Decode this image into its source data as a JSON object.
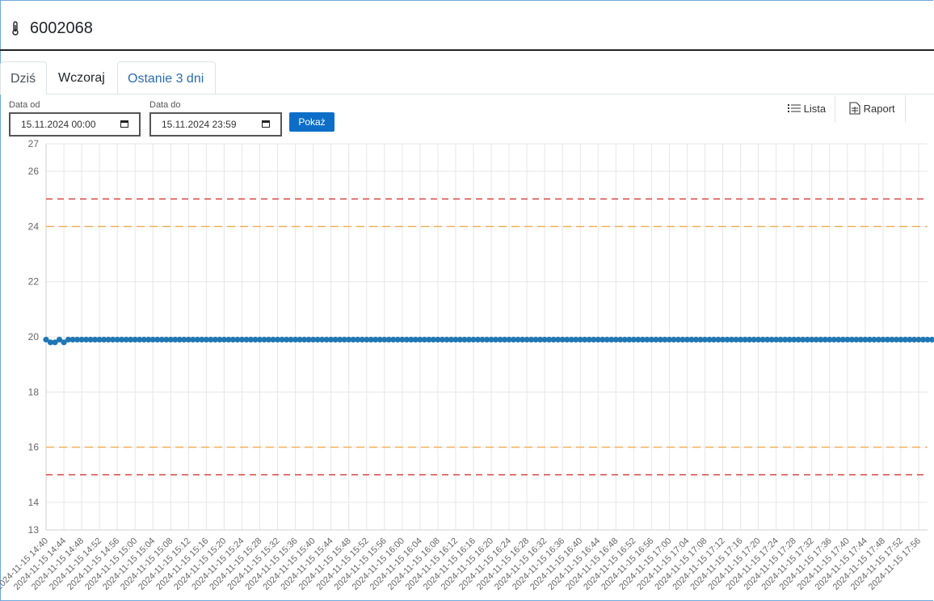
{
  "header": {
    "title": "6002068",
    "icon": "thermometer-icon"
  },
  "tabs": [
    {
      "label": "Dziś",
      "active": true
    },
    {
      "label": "Wczoraj",
      "active": false
    },
    {
      "label": "Ostanie 3 dni",
      "active": false
    }
  ],
  "filters": {
    "from_label": "Data od",
    "from_value": "15.11.2024 00:00",
    "to_label": "Data do",
    "to_value": "15.11.2024 23:59",
    "show_button": "Pokaż"
  },
  "toolbar": {
    "list_label": "Lista",
    "report_label": "Raport"
  },
  "colors": {
    "series": "#1f77b4",
    "alarm_line": "#d9534f",
    "warning_line": "#f0ad4e",
    "button": "#0d6ec8",
    "tab_link": "#2b6cb0"
  },
  "chart_data": {
    "type": "line",
    "ylim": [
      13,
      27
    ],
    "yticks": [
      "13",
      "14",
      "16",
      "18",
      "20",
      "22",
      "24",
      "26",
      "27"
    ],
    "grid": true,
    "x_labels": [
      "2024-11-15 14:40",
      "2024-11-15 14:44",
      "2024-11-15 14:48",
      "2024-11-15 14:52",
      "2024-11-15 14:56",
      "2024-11-15 15:00",
      "2024-11-15 15:04",
      "2024-11-15 15:08",
      "2024-11-15 15:12",
      "2024-11-15 15:16",
      "2024-11-15 15:20",
      "2024-11-15 15:24",
      "2024-11-15 15:28",
      "2024-11-15 15:32",
      "2024-11-15 15:36",
      "2024-11-15 15:40",
      "2024-11-15 15:44",
      "2024-11-15 15:48",
      "2024-11-15 15:52",
      "2024-11-15 15:56",
      "2024-11-15 16:00",
      "2024-11-15 16:04",
      "2024-11-15 16:08",
      "2024-11-15 16:12",
      "2024-11-15 16:16",
      "2024-11-15 16:20",
      "2024-11-15 16:24",
      "2024-11-15 16:28",
      "2024-11-15 16:32",
      "2024-11-15 16:36",
      "2024-11-15 16:40",
      "2024-11-15 16:44",
      "2024-11-15 16:48",
      "2024-11-15 16:52",
      "2024-11-15 16:56",
      "2024-11-15 17:00",
      "2024-11-15 17:04",
      "2024-11-15 17:08",
      "2024-11-15 17:12",
      "2024-11-15 17:16",
      "2024-11-15 17:20",
      "2024-11-15 17:24",
      "2024-11-15 17:28",
      "2024-11-15 17:32",
      "2024-11-15 17:36",
      "2024-11-15 17:40",
      "2024-11-15 17:44",
      "2024-11-15 17:48",
      "2024-11-15 17:52",
      "2024-11-15 17:56"
    ],
    "x_start": "2024-11-15 14:40",
    "x_end": "2024-11-15 17:58",
    "sample_interval_min": 1,
    "series": [
      {
        "values": [
          19.9,
          19.8,
          19.8,
          19.9,
          19.8,
          19.9,
          19.9,
          19.9,
          19.9,
          19.9,
          19.9,
          19.9,
          19.9,
          19.9,
          19.9,
          19.9,
          19.9,
          19.9,
          19.9,
          19.9,
          19.9,
          19.9,
          19.9,
          19.9,
          19.9,
          19.9,
          19.9,
          19.9,
          19.9,
          19.9,
          19.9,
          19.9,
          19.9,
          19.9,
          19.9,
          19.9,
          19.9,
          19.9,
          19.9,
          19.9,
          19.9,
          19.9,
          19.9,
          19.9,
          19.9,
          19.9,
          19.9,
          19.9,
          19.9,
          19.9,
          19.9,
          19.9,
          19.9,
          19.9,
          19.9,
          19.9,
          19.9,
          19.9,
          19.9,
          19.9,
          19.9,
          19.9,
          19.9,
          19.9,
          19.9,
          19.9,
          19.9,
          19.9,
          19.9,
          19.9,
          19.9,
          19.9,
          19.9,
          19.9,
          19.9,
          19.9,
          19.9,
          19.9,
          19.9,
          19.9,
          19.9,
          19.9,
          19.9,
          19.9,
          19.9,
          19.9,
          19.9,
          19.9,
          19.9,
          19.9,
          19.9,
          19.9,
          19.9,
          19.9,
          19.9,
          19.9,
          19.9,
          19.9,
          19.9,
          19.9,
          19.9,
          19.9,
          19.9,
          19.9,
          19.9,
          19.9,
          19.9,
          19.9,
          19.9,
          19.9,
          19.9,
          19.9,
          19.9,
          19.9,
          19.9,
          19.9,
          19.9,
          19.9,
          19.9,
          19.9,
          19.9,
          19.9,
          19.9,
          19.9,
          19.9,
          19.9,
          19.9,
          19.9,
          19.9,
          19.9,
          19.9,
          19.9,
          19.9,
          19.9,
          19.9,
          19.9,
          19.9,
          19.9,
          19.9,
          19.9,
          19.9,
          19.9,
          19.9,
          19.9,
          19.9,
          19.9,
          19.9,
          19.9,
          19.9,
          19.9,
          19.9,
          19.9,
          19.9,
          19.9,
          19.9,
          19.9,
          19.9,
          19.9,
          19.9,
          19.9,
          19.9,
          19.9,
          19.9,
          19.9,
          19.9,
          19.9,
          19.9,
          19.9,
          19.9,
          19.9,
          19.9,
          19.9,
          19.9,
          19.9,
          19.9,
          19.9,
          19.9,
          19.9,
          19.9,
          19.9,
          19.9,
          19.9,
          19.9,
          19.9,
          19.9,
          19.9,
          19.9,
          19.9,
          19.9,
          19.9,
          19.9,
          19.9,
          19.9,
          19.9,
          19.9,
          19.9,
          19.9,
          19.9,
          19.9,
          19.9,
          19.9,
          19.9,
          19.9,
          19.9,
          19.9,
          19.9,
          19.9
        ]
      }
    ],
    "thresholds": [
      {
        "value": 25,
        "kind": "alarm"
      },
      {
        "value": 24,
        "kind": "warning"
      },
      {
        "value": 16,
        "kind": "warning"
      },
      {
        "value": 15,
        "kind": "alarm"
      }
    ]
  }
}
